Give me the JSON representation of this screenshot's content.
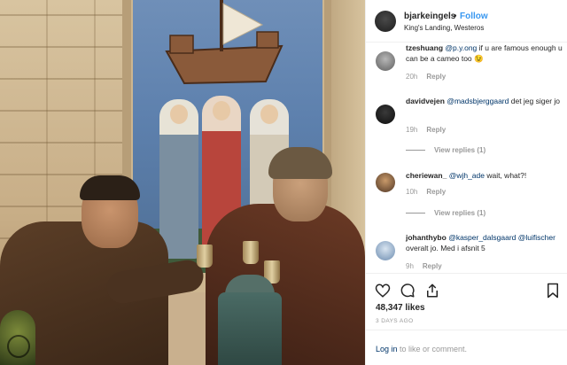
{
  "post": {
    "username": "bjarkeingels",
    "separator": "•",
    "follow_label": "Follow",
    "location": "King's Landing, Westeros"
  },
  "comments": [
    {
      "username": "tzeshuang",
      "mention": "@p.y.ong",
      "text": " if u are famous enough u can be a cameo too 😉",
      "time": "20h",
      "reply_label": "Reply"
    },
    {
      "username": "davidvejen",
      "mention": "@madsbjerggaard",
      "text": " det jeg siger jo",
      "time": "19h",
      "reply_label": "Reply",
      "view_replies": "View replies (1)"
    },
    {
      "username": "cheriewan_",
      "mention": "@wjh_ade",
      "text": " wait, what?!",
      "time": "10h",
      "reply_label": "Reply",
      "view_replies": "View replies (1)"
    },
    {
      "username": "johanthybo",
      "mention": "@kasper_dalsgaard",
      "mention2": "@luifischer",
      "text": " overalt jo. Med i afsnit 5",
      "time": "9h",
      "reply_label": "Reply"
    }
  ],
  "actions": {
    "like_icon": "heart-icon",
    "comment_icon": "comment-icon",
    "share_icon": "share-icon",
    "save_icon": "bookmark-icon"
  },
  "likes": "48,347 likes",
  "posted_ago": "3 DAYS AGO",
  "login": {
    "link": "Log in",
    "rest": " to like or comment."
  },
  "colors": {
    "accent": "#3897f0",
    "link": "#003569",
    "muted": "#999999",
    "text": "#262626"
  }
}
